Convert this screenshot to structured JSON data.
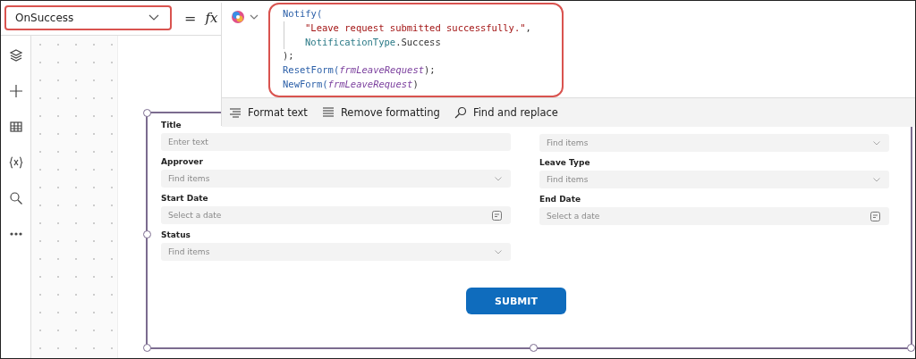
{
  "property_selector": {
    "value": "OnSuccess"
  },
  "formula_bar": {
    "equals": "=",
    "fx": "fx",
    "code_lines": [
      {
        "indented": false,
        "segments": [
          {
            "text": "Notify(",
            "kind": "function"
          }
        ]
      },
      {
        "indented": true,
        "segments": [
          {
            "text": "\"Leave request submitted successfully.\"",
            "kind": "string"
          },
          {
            "text": ",",
            "kind": "punct"
          }
        ]
      },
      {
        "indented": true,
        "segments": [
          {
            "text": "NotificationType",
            "kind": "enum"
          },
          {
            "text": ".Success",
            "kind": "punct"
          }
        ]
      },
      {
        "indented": false,
        "segments": [
          {
            "text": ");",
            "kind": "punct"
          }
        ]
      },
      {
        "indented": false,
        "segments": [
          {
            "text": "ResetForm(",
            "kind": "function"
          },
          {
            "text": "frmLeaveRequest",
            "kind": "param"
          },
          {
            "text": ");",
            "kind": "punct"
          }
        ]
      },
      {
        "indented": false,
        "segments": [
          {
            "text": "NewForm(",
            "kind": "function"
          },
          {
            "text": "frmLeaveRequest",
            "kind": "param"
          },
          {
            "text": ")",
            "kind": "punct"
          }
        ]
      }
    ],
    "toolbar": [
      {
        "label": "Format text",
        "kind": "format"
      },
      {
        "label": "Remove formatting",
        "kind": "remove"
      },
      {
        "label": "Find and replace",
        "kind": "find"
      }
    ]
  },
  "left_rail": [
    {
      "kind": "layers"
    },
    {
      "kind": "add"
    },
    {
      "kind": "table"
    },
    {
      "kind": "variables"
    },
    {
      "kind": "search"
    },
    {
      "kind": "more"
    }
  ],
  "form": {
    "columns": [
      [
        {
          "label": "Title",
          "kind": "text",
          "placeholder": "Enter text"
        },
        {
          "label": "Approver",
          "kind": "dropdown",
          "placeholder": "Find items"
        },
        {
          "label": "Start Date",
          "kind": "date",
          "placeholder": "Select a date"
        },
        {
          "label": "Status",
          "kind": "dropdown",
          "placeholder": "Find items"
        }
      ],
      [
        {
          "kind": "dropdown",
          "placeholder": "Find items"
        },
        {
          "label": "Leave Type",
          "kind": "dropdown",
          "placeholder": "Find items"
        },
        {
          "label": "End Date",
          "kind": "date",
          "placeholder": "Select a date"
        }
      ]
    ],
    "submit_button": "SUBMIT"
  }
}
